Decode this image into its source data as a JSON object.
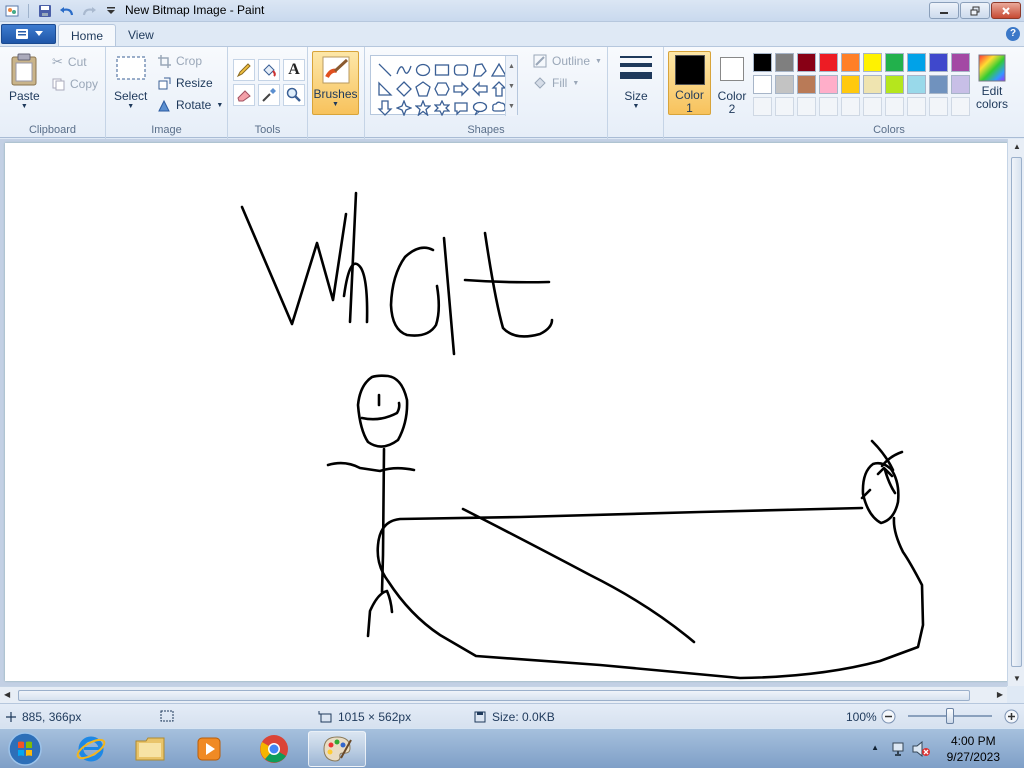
{
  "window": {
    "title": "New Bitmap Image - Paint"
  },
  "tabs": [
    {
      "label": "Home"
    },
    {
      "label": "View"
    }
  ],
  "ribbon": {
    "clipboard": {
      "label": "Clipboard",
      "paste": "Paste",
      "cut": "Cut",
      "copy": "Copy"
    },
    "image": {
      "label": "Image",
      "select": "Select",
      "crop": "Crop",
      "resize": "Resize",
      "rotate": "Rotate"
    },
    "tools": {
      "label": "Tools"
    },
    "brushes": {
      "label": "Brushes"
    },
    "shapes": {
      "label": "Shapes",
      "outline": "Outline",
      "fill": "Fill"
    },
    "size": {
      "label": "Size"
    },
    "color1": {
      "label_line1": "Color",
      "label_line2": "1",
      "value": "#000000"
    },
    "color2": {
      "label_line1": "Color",
      "label_line2": "2",
      "value": "#ffffff"
    },
    "colors": {
      "label": "Colors",
      "edit_line1": "Edit",
      "edit_line2": "colors",
      "palette": [
        "#000000",
        "#7f7f7f",
        "#880015",
        "#ed1c24",
        "#ff7f27",
        "#fff200",
        "#22b14c",
        "#00a2e8",
        "#3f48cc",
        "#a349a4",
        "#ffffff",
        "#c3c3c3",
        "#b97a57",
        "#ffaec9",
        "#ffc90e",
        "#efe4b0",
        "#b5e61d",
        "#99d9ea",
        "#7092be",
        "#c8bfe7",
        "#f2f5f9",
        "#f2f5f9",
        "#f2f5f9",
        "#f2f5f9",
        "#f2f5f9",
        "#f2f5f9",
        "#f2f5f9",
        "#f2f5f9",
        "#f2f5f9",
        "#f2f5f9"
      ]
    }
  },
  "status": {
    "cursor": "885, 366px",
    "canvas_size": "1015 × 562px",
    "file_size": "Size: 0.0KB",
    "zoom": "100%"
  },
  "taskbar": {
    "time": "4:00 PM",
    "date": "9/27/2023"
  }
}
